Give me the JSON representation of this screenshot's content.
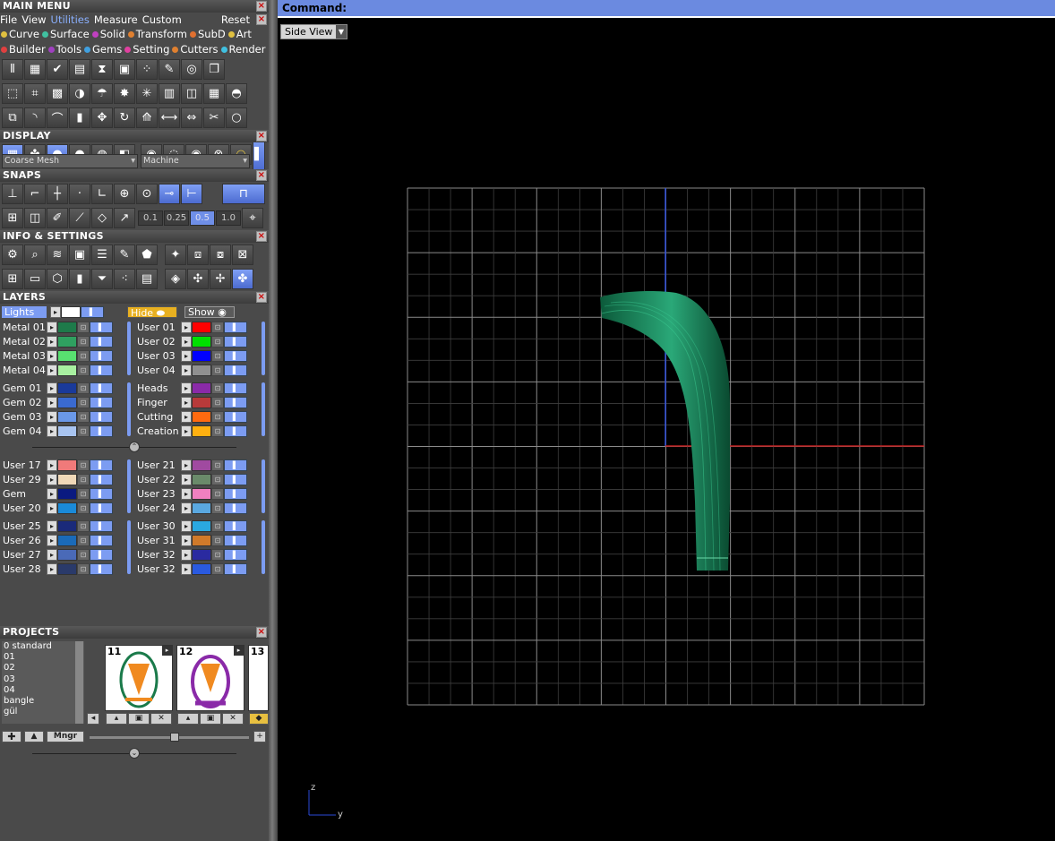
{
  "main_menu": {
    "title": "MAIN MENU",
    "menu_items": [
      "File",
      "View",
      "Utilities",
      "Measure",
      "Custom"
    ],
    "active_item": "Utilities",
    "reset_label": "Reset",
    "categories_row1": [
      {
        "label": "Curve",
        "color": "#e0c040"
      },
      {
        "label": "Surface",
        "color": "#40c0a0"
      },
      {
        "label": "Solid",
        "color": "#c040c0"
      },
      {
        "label": "Transform",
        "color": "#e08030"
      },
      {
        "label": "SubD",
        "color": "#e07030"
      },
      {
        "label": "Art",
        "color": "#e0c040"
      }
    ],
    "categories_row2": [
      {
        "label": "Builder",
        "color": "#e04040"
      },
      {
        "label": "Tools",
        "color": "#a040c0"
      },
      {
        "label": "Gems",
        "color": "#40a0e0"
      },
      {
        "label": "Setting",
        "color": "#e040a0"
      },
      {
        "label": "Cutters",
        "color": "#e08030"
      },
      {
        "label": "Render",
        "color": "#40c0e0"
      }
    ]
  },
  "display": {
    "title": "DISPLAY",
    "mesh_select": "Coarse Mesh",
    "material_select": "Machine"
  },
  "snaps": {
    "title": "SNAPS",
    "values": [
      "0.1",
      "0.25",
      "0.5",
      "1.0"
    ],
    "active_value": "0.5"
  },
  "info_settings": {
    "title": "INFO & SETTINGS"
  },
  "layers": {
    "title": "LAYERS",
    "lights_label": "Lights",
    "hide_label": "Hide",
    "show_label": "Show",
    "groups": [
      {
        "left": [
          {
            "name": "Metal 01",
            "color": "#1e7a4a"
          },
          {
            "name": "Metal 02",
            "color": "#2fa060"
          },
          {
            "name": "Metal 03",
            "color": "#58e070"
          },
          {
            "name": "Metal 04",
            "color": "#a8f0a0"
          }
        ],
        "right": [
          {
            "name": "User 01",
            "color": "#ff0000"
          },
          {
            "name": "User 02",
            "color": "#00e000"
          },
          {
            "name": "User 03",
            "color": "#0000ff"
          },
          {
            "name": "User 04",
            "color": "#909090"
          }
        ]
      },
      {
        "left": [
          {
            "name": "Gem 01",
            "color": "#1a3a9a"
          },
          {
            "name": "Gem 02",
            "color": "#3a6ad0"
          },
          {
            "name": "Gem 03",
            "color": "#6a98e8"
          },
          {
            "name": "Gem 04",
            "color": "#a8c4f0"
          }
        ],
        "right": [
          {
            "name": "Heads",
            "color": "#8a2aa8"
          },
          {
            "name": "Finger",
            "color": "#b83a3a"
          },
          {
            "name": "Cutting",
            "color": "#ff6a10"
          },
          {
            "name": "Creation",
            "color": "#ffb010"
          }
        ]
      },
      {
        "left": [
          {
            "name": "User 17",
            "color": "#f07a7a"
          },
          {
            "name": "User 29",
            "color": "#f0d8b8"
          },
          {
            "name": "Gem",
            "color": "#0a1a80"
          },
          {
            "name": "User 20",
            "color": "#1a8ad8"
          }
        ],
        "right": [
          {
            "name": "User 21",
            "color": "#a04aa0"
          },
          {
            "name": "User 22",
            "color": "#6a8a6a"
          },
          {
            "name": "User 23",
            "color": "#f080c0"
          },
          {
            "name": "User 24",
            "color": "#5aa8e0"
          }
        ]
      },
      {
        "left": [
          {
            "name": "User 25",
            "color": "#1a2a7a"
          },
          {
            "name": "User 26",
            "color": "#1a6ab8"
          },
          {
            "name": "User 27",
            "color": "#4a6ab8"
          },
          {
            "name": "User 28",
            "color": "#2a3a6a"
          }
        ],
        "right": [
          {
            "name": "User 30",
            "color": "#2aa8e0"
          },
          {
            "name": "User 31",
            "color": "#d07a2a"
          },
          {
            "name": "User 32",
            "color": "#2a2aa0"
          },
          {
            "name": "User 32",
            "color": "#2a5ae0"
          }
        ]
      }
    ]
  },
  "projects": {
    "title": "PROJECTS",
    "list": [
      "0 standard",
      "01",
      "02",
      "03",
      "04",
      "bangle",
      "gül"
    ],
    "thumbnails": [
      "11",
      "12",
      "13"
    ],
    "manager_label": "Mngr"
  },
  "command": {
    "label": "Command:"
  },
  "viewport": {
    "view_name": "Side View",
    "axis_z": "z",
    "axis_y": "y",
    "model_color": "#1a8a5a"
  }
}
